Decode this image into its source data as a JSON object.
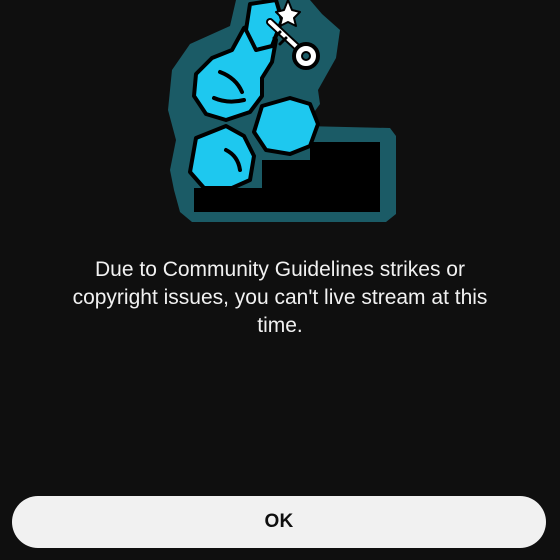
{
  "dialog": {
    "illustration_icon": "locked-live-stream-illustration",
    "message": "Due to Community Guidelines strikes or copyright issues, you can't live stream at this time.",
    "ok_label": "OK"
  },
  "colors": {
    "background": "#0f0f0f",
    "text": "#f1f1f1",
    "button_bg": "#f1f1f1",
    "button_text": "#0f0f0f",
    "accent_cyan": "#1ec8ef",
    "accent_teal": "#1b5b66"
  }
}
